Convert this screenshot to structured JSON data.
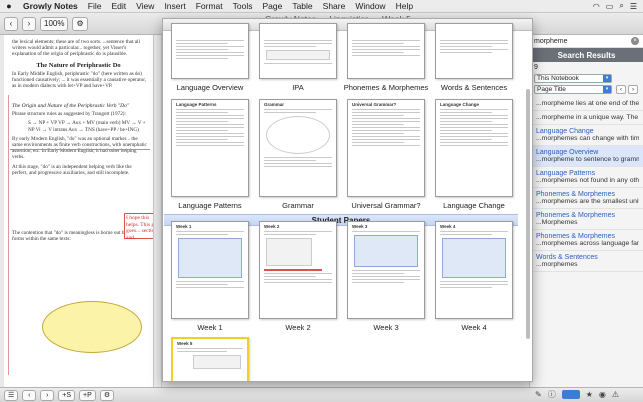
{
  "menubar": {
    "app": "Growly Notes",
    "items": [
      "File",
      "Edit",
      "View",
      "Insert",
      "Format",
      "Tools",
      "Page",
      "Table",
      "Share",
      "Window",
      "Help"
    ]
  },
  "toolbar": {
    "zoom": "100%",
    "window_title": "Growly Notes — Linguistics — Week 5"
  },
  "document": {
    "intro": "the lexical elements; these are of two sorts. ...sentence that all writers would admit a particular... together, yet Visser's explanation of the origin of periphrastic do is plausible.",
    "heading1": "The Nature of Periphrastic Do",
    "para1": "In Early Middle English, periphrastic \"do\" (here written as do) functioned causatively; ... it was essentially a causative operator, as in modern dialects with let+VP and have+VP.",
    "subheading": "The Origin and Nature of the Periphrastic Verb \"Do\"",
    "para2": "Phrase structure rules as suggested by Traugott (1972):",
    "rules": "S → NP + VP   VP → Aux + MV (main verb)   MV → V + NP   Vi → V intrans   Aux → TNS (have+PP / be+ING)",
    "para3": "By early Modern English, \"do\" was an optional marker... the same environments as finite verb constructions, with unemphatic assertion, etc. In Early Modern English, it had other helping verbs.",
    "para4": "At this stage, \"do\" is an independent helping verb like the perfect, and progressive auxiliaries, and still incomplete.",
    "para5": "The contention that \"do\" is meaningless is borne out by these forms within the same texts:",
    "note": "I hope this helps. This guy goes... section and..."
  },
  "overview": {
    "section_label": "Student Papers",
    "top_row": [
      {
        "label": "Language Overview"
      },
      {
        "label": "IPA"
      },
      {
        "label": "Phonemes & Morphemes"
      },
      {
        "label": "Words & Sentences"
      }
    ],
    "middle_row": [
      {
        "label": "Language Patterns",
        "title": "Language Patterns"
      },
      {
        "label": "Grammar",
        "title": "Grammar"
      },
      {
        "label": "Universal Grammar?",
        "title": "Universal Grammar?"
      },
      {
        "label": "Language Change",
        "title": "Language Change"
      }
    ],
    "papers": [
      {
        "label": "Week 1",
        "title": "Week 1"
      },
      {
        "label": "Week 2",
        "title": "Week 2"
      },
      {
        "label": "Week 3",
        "title": "Week 3"
      },
      {
        "label": "Week 4",
        "title": "Week 4"
      },
      {
        "label": "",
        "title": "Week 5"
      }
    ]
  },
  "sidebar": {
    "search_value": "morpheme",
    "title": "Search Results",
    "count": "9",
    "scope": "This Notebook",
    "sort": "Page Title",
    "results": [
      {
        "title": "",
        "snippet": "...morpheme lies at one end of the spectrum o..."
      },
      {
        "title": "",
        "snippet": "...morpheme in a unique way. The symbol al..."
      },
      {
        "title": "Language Change",
        "snippet": "...morphemes can change with time, morphin..."
      },
      {
        "title": "Language Overview",
        "snippet": "...morpheme to sentence to grammar and exa..."
      },
      {
        "title": "Language Patterns",
        "snippet": "...morphemes not found in any other language..."
      },
      {
        "title": "Phonemes & Morphemes",
        "snippet": "...morphemes are the smallest unit of sound in h..."
      },
      {
        "title": "Phonemes & Morphemes",
        "snippet": "...Morphemes"
      },
      {
        "title": "Phonemes & Morphemes",
        "snippet": "...morphemes across language families and withi..."
      },
      {
        "title": "Words & Sentences",
        "snippet": "...morphemes"
      }
    ]
  },
  "colors": {
    "accent": "#3d7bd9",
    "result_link": "#2a5fbf",
    "highlight": "#fbf3a8",
    "annotation": "#e05050",
    "week5_border": "#f3cd2a"
  }
}
